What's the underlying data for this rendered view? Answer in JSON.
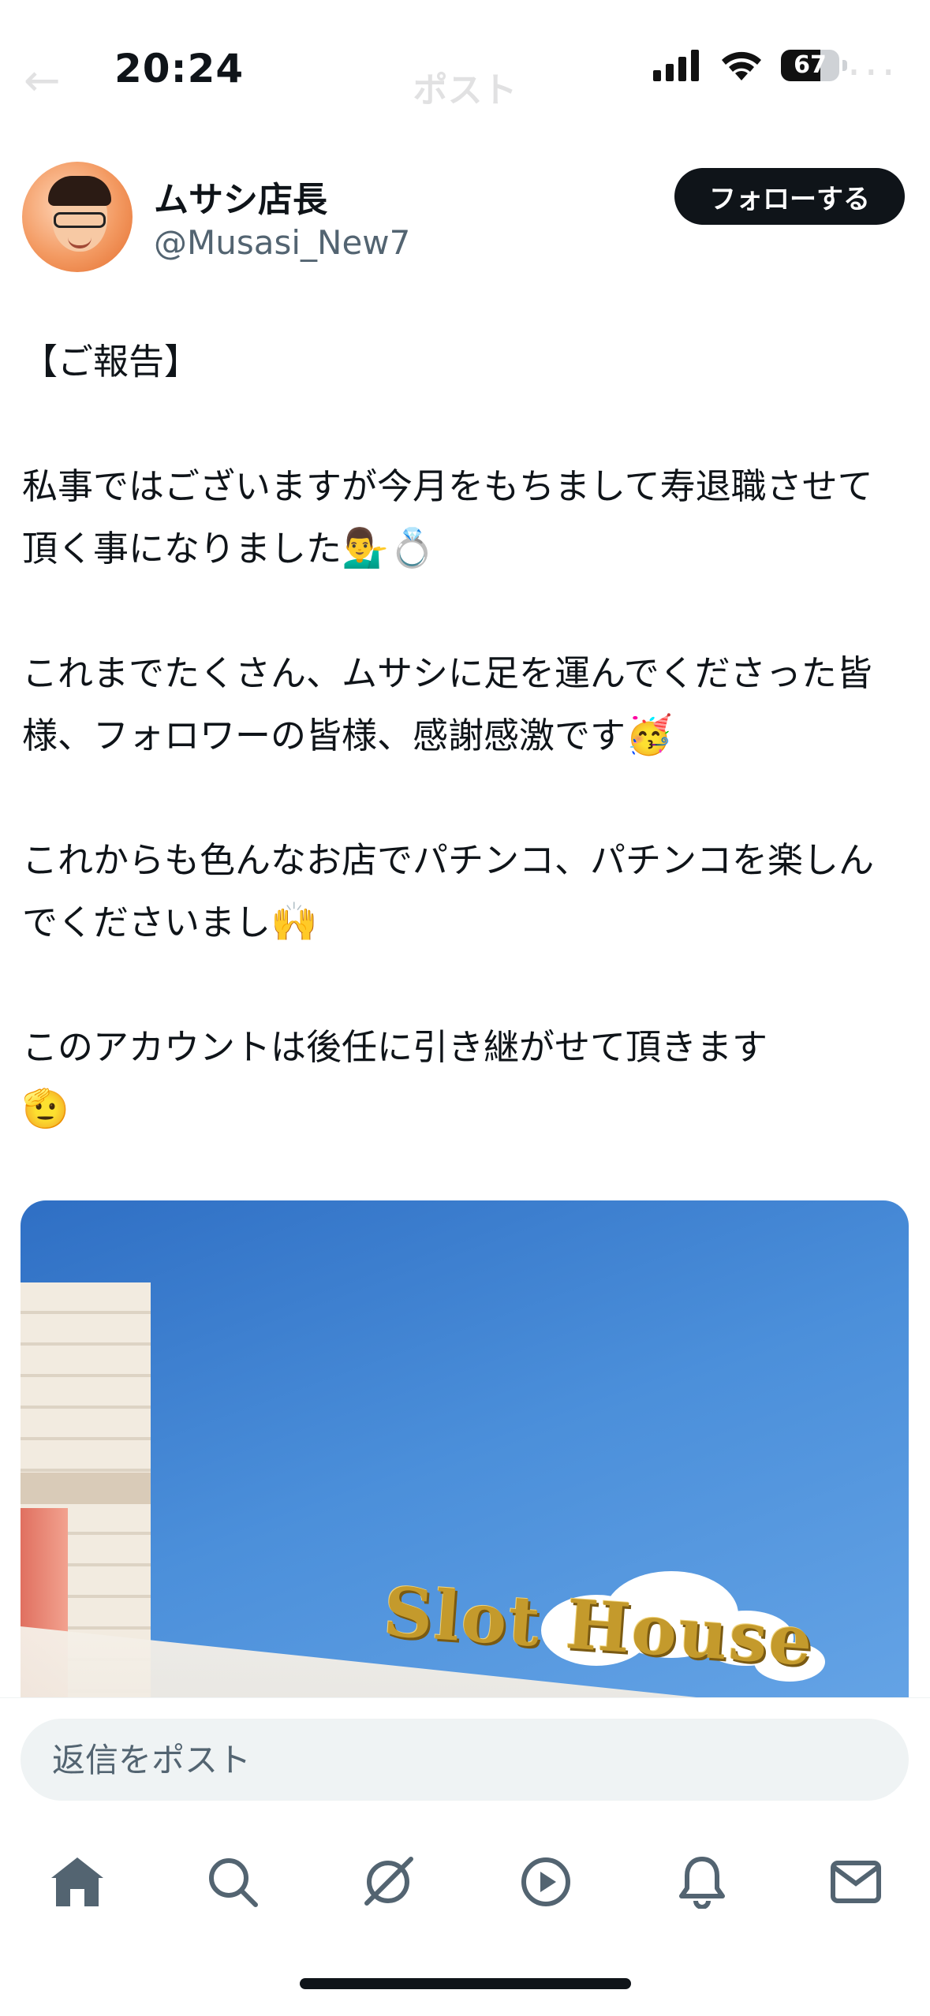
{
  "status_bar": {
    "time": "20:24",
    "battery": "67",
    "battery_fraction": 0.67,
    "icons": [
      "signal-icon",
      "wifi-icon",
      "battery-icon"
    ]
  },
  "header": {
    "title": "ポスト",
    "icons": [
      "back-arrow-icon",
      "more-icon"
    ]
  },
  "author": {
    "name": "ムサシ店長",
    "handle": "@Musasi_New7",
    "follow_label": "フォローする"
  },
  "post": {
    "paragraphs": [
      "【ご報告】",
      "私事ではございますが今月をもちまして寿退職させて頂く事になりました",
      "これまでたくさん、ムサシに足を運んでくださった皆様、フォロワーの皆様、感謝感激です",
      "これからも色んなお店でパチンコ、パチンコを楽しんでくださいまし",
      "このアカウントは後任に引き継がせて頂きます"
    ],
    "emojis": [
      "💁‍♂️",
      "💍",
      "🥳",
      "🙌",
      "🫡"
    ],
    "image_sign_text": "Slot House"
  },
  "reply": {
    "placeholder": "返信をポスト"
  },
  "nav": {
    "items": [
      "home-icon",
      "search-icon",
      "grok-icon",
      "video-icon",
      "notifications-icon",
      "messages-icon"
    ]
  },
  "colors": {
    "text": "#0f1419",
    "secondary": "#536471",
    "button_bg": "#0f1419",
    "input_bg": "#eff3f4",
    "nav_icon": "#536471"
  }
}
